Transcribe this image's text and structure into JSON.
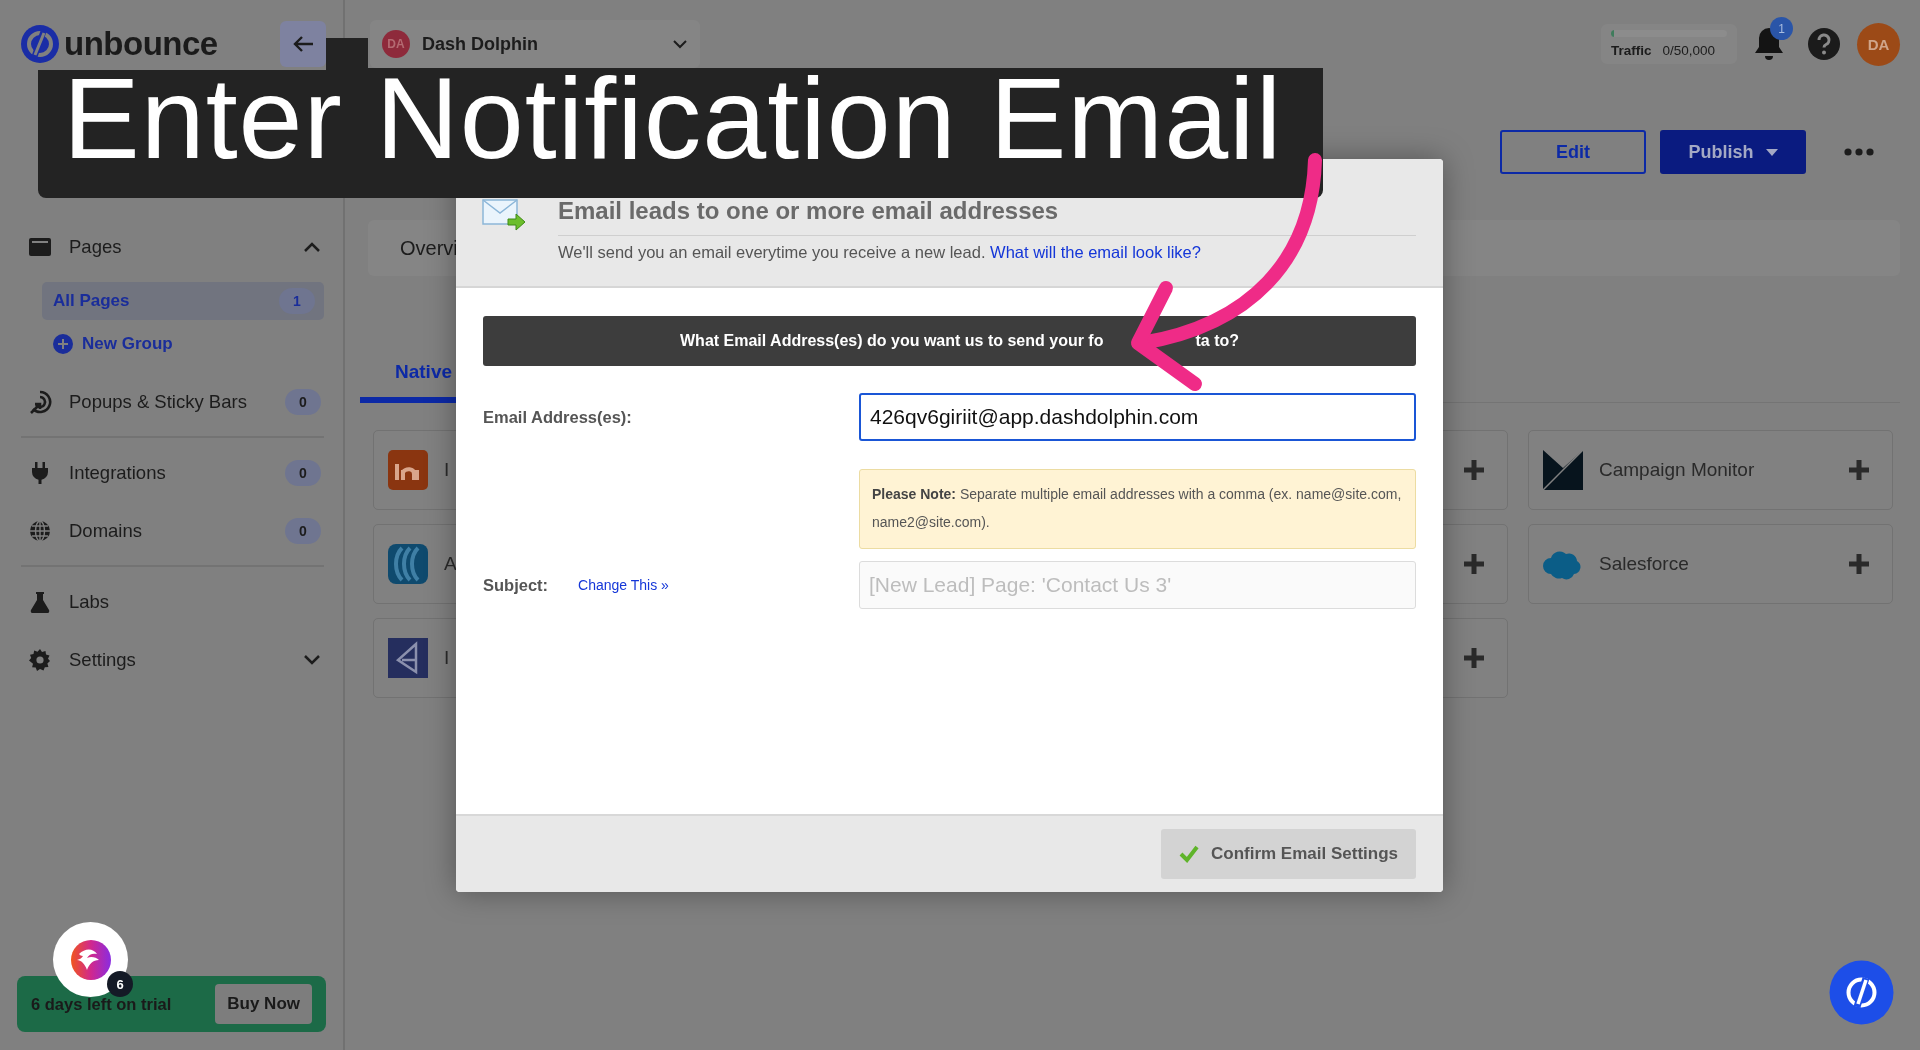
{
  "header": {
    "logo": "unbounce",
    "workspace": {
      "initials": "DA",
      "name": "Dash Dolphin"
    },
    "traffic": {
      "label": "Traffic",
      "value": "0/50,000",
      "level": 0.03
    },
    "notification_count": "1",
    "user_initials": "DA"
  },
  "page_actions": [
    {
      "kind": "outline",
      "label": "Edit"
    },
    {
      "kind": "primary",
      "label": "Publish"
    }
  ],
  "sidebar": {
    "groups": [
      [
        {
          "label": "Pages",
          "expanded": true,
          "children": [
            {
              "label": "All Pages",
              "count": "1",
              "selected": true
            }
          ],
          "add_link": "New Group"
        },
        {
          "label": "Popups & Sticky Bars",
          "count": "0"
        }
      ],
      [
        {
          "label": "Integrations",
          "count": "0"
        },
        {
          "label": "Domains",
          "count": "0"
        }
      ],
      [
        {
          "label": "Labs"
        },
        {
          "label": "Settings",
          "expanded": false
        }
      ]
    ]
  },
  "trial": {
    "text": "6 days left on trial",
    "button": "Buy Now",
    "helper_badge": "6"
  },
  "main": {
    "tabs": [
      {
        "label": "Overvi"
      }
    ],
    "subtabs": [
      {
        "label": "Native",
        "selected": true
      }
    ],
    "integration_columns": [
      [
        {
          "kind": "app",
          "label": "I"
        },
        {
          "kind": "app",
          "label": "A"
        },
        {
          "kind": "app",
          "label": "I"
        }
      ],
      [
        {
          "kind": "blank"
        },
        {
          "kind": "blank"
        },
        {
          "kind": "blank"
        }
      ],
      [
        {
          "kind": "app",
          "label": "Campaign Monitor"
        },
        {
          "kind": "app",
          "label": "Salesforce"
        }
      ]
    ]
  },
  "modal": {
    "title": "Email leads to one or more email addresses",
    "subtitle": "We'll send you an email everytime you receive a new lead.",
    "subtitle_link": "What will the email look like?",
    "question": [
      "What Email Address(es) do you want us to send your fo",
      "ta to?"
    ],
    "fields": [
      {
        "kind": "input",
        "label": "Email Address(es):",
        "value": "426qv6giriit@app.dashdolphin.com",
        "focused": true
      },
      {
        "kind": "readonly",
        "label": "Subject:",
        "link": "Change This »",
        "placeholder": "[New Lead] Page: 'Contact Us 3'"
      }
    ],
    "note": "**Please Note:** Separate multiple email addresses with a comma (ex. name@site.com, name2@site.com).",
    "confirm_button": "Confirm Email Settings"
  },
  "caption": "Enter Notification Email"
}
